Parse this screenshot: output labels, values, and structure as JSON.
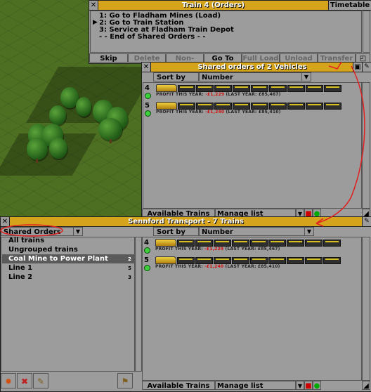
{
  "orders_window": {
    "title": "Train 4 (Orders)",
    "timetable_label": "Timetable",
    "orders": [
      "1: Go to Fladham Mines (Load)",
      "2: Go to Train Station",
      "3: Service at Fladham Train Depot",
      "- - End of Shared Orders - -"
    ],
    "buttons": [
      "Skip",
      "Delete",
      "Non-Stop",
      "Go To",
      "Full Load",
      "Unload",
      "Transfer"
    ]
  },
  "shared_window": {
    "title": "Shared orders of 2 Vehicles",
    "sort_label": "Sort by",
    "sort_value": "Number",
    "bottom_available": "Available Trains",
    "bottom_manage": "Manage list"
  },
  "vehicles": [
    {
      "number": "4",
      "profit_label": "PROFIT THIS YEAR:",
      "profit_value": "-£1,229",
      "last_year": "(LAST YEAR: £85,467)"
    },
    {
      "number": "5",
      "profit_label": "PROFIT THIS YEAR:",
      "profit_value": "-£1,240",
      "last_year": "(LAST YEAR: £85,410)"
    }
  ],
  "transport_window": {
    "title": "Sennford Transport - 7 Trains",
    "group_filter": "Shared Orders",
    "sort_label": "Sort by",
    "sort_value": "Number",
    "groups": [
      {
        "label": "All trains",
        "count": ""
      },
      {
        "label": "Ungrouped trains",
        "count": ""
      },
      {
        "label": "Coal Mine to Power Plant",
        "count": "2"
      },
      {
        "label": "Line 1",
        "count": "5"
      },
      {
        "label": "Line 2",
        "count": "3"
      }
    ],
    "bottom_available": "Available Trains",
    "bottom_manage": "Manage list"
  },
  "colors": {
    "title_bar": "#d6a41c",
    "window_bg": "#9c9c9c",
    "annotation": "#e02020",
    "negative_profit": "#d01010"
  }
}
